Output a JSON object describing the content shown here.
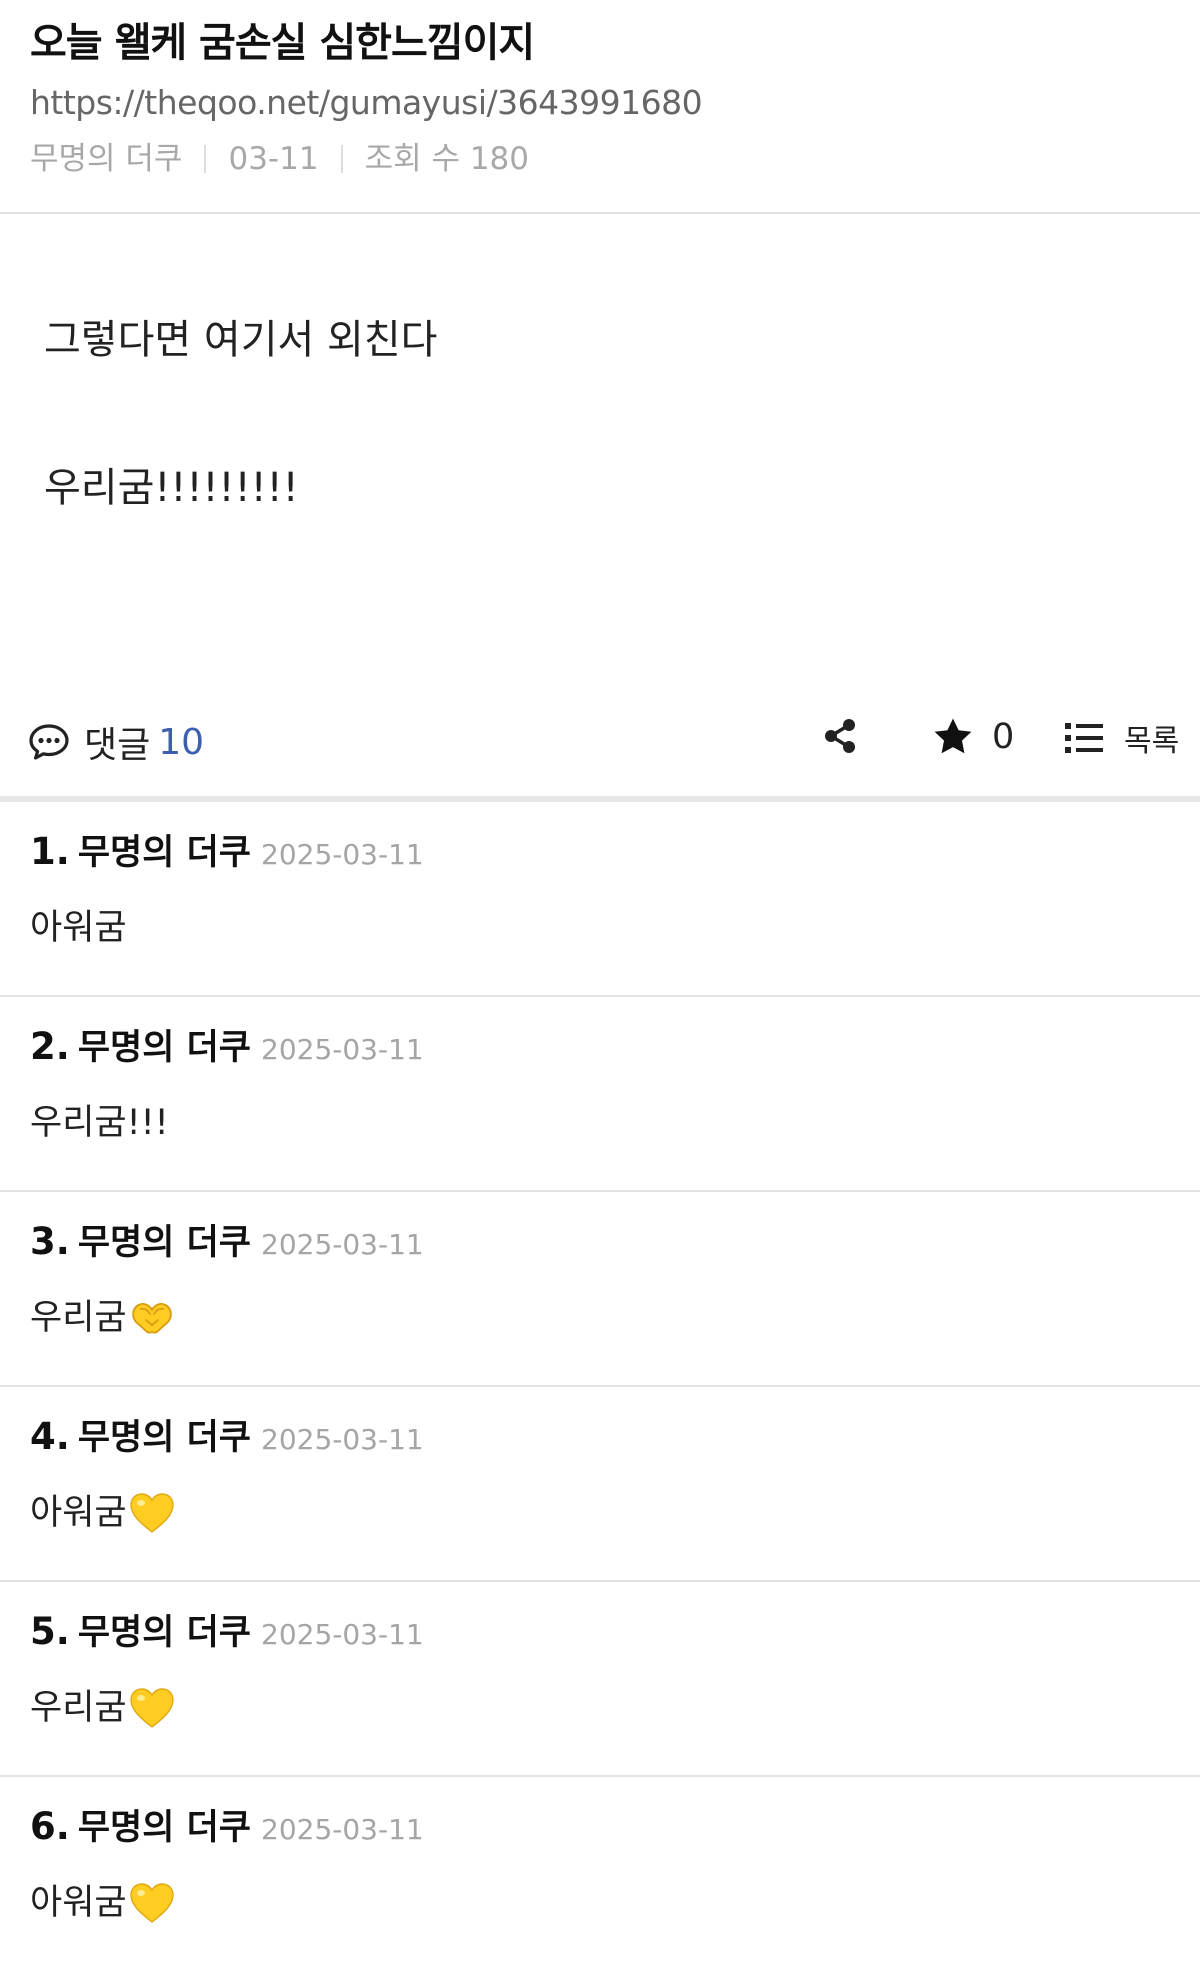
{
  "post": {
    "title": "오늘 왤케 굼손실 심한느낌이지",
    "url": "https://theqoo.net/gumayusi/3643991680",
    "author": "무명의 더쿠",
    "date": "03-11",
    "views_label": "조회 수 180"
  },
  "content": {
    "lines": [
      "그렇다면 여기서 외친다",
      "우리굼!!!!!!!!!"
    ]
  },
  "actions": {
    "comment_label": "댓글",
    "comment_count": "10",
    "star_count": "0",
    "list_label": "목록",
    "icons": {
      "comment": "comment-bubble-icon",
      "share": "share-icon",
      "star": "star-icon",
      "list": "list-icon"
    }
  },
  "comments": [
    {
      "index": "1.",
      "author": "무명의 더쿠",
      "date": "2025-03-11",
      "text": "아워굼",
      "emoji": ""
    },
    {
      "index": "2.",
      "author": "무명의 더쿠",
      "date": "2025-03-11",
      "text": "우리굼!!!",
      "emoji": ""
    },
    {
      "index": "3.",
      "author": "무명의 더쿠",
      "date": "2025-03-11",
      "text": "우리굼",
      "emoji": "heart-hands"
    },
    {
      "index": "4.",
      "author": "무명의 더쿠",
      "date": "2025-03-11",
      "text": "아워굼",
      "emoji": "yellow-heart"
    },
    {
      "index": "5.",
      "author": "무명의 더쿠",
      "date": "2025-03-11",
      "text": "우리굼",
      "emoji": "yellow-heart"
    },
    {
      "index": "6.",
      "author": "무명의 더쿠",
      "date": "2025-03-11",
      "text": "아워굼",
      "emoji": "yellow-heart"
    }
  ],
  "colors": {
    "accent": "#3c5fb0",
    "emoji_yellow": "#ffcc22"
  }
}
